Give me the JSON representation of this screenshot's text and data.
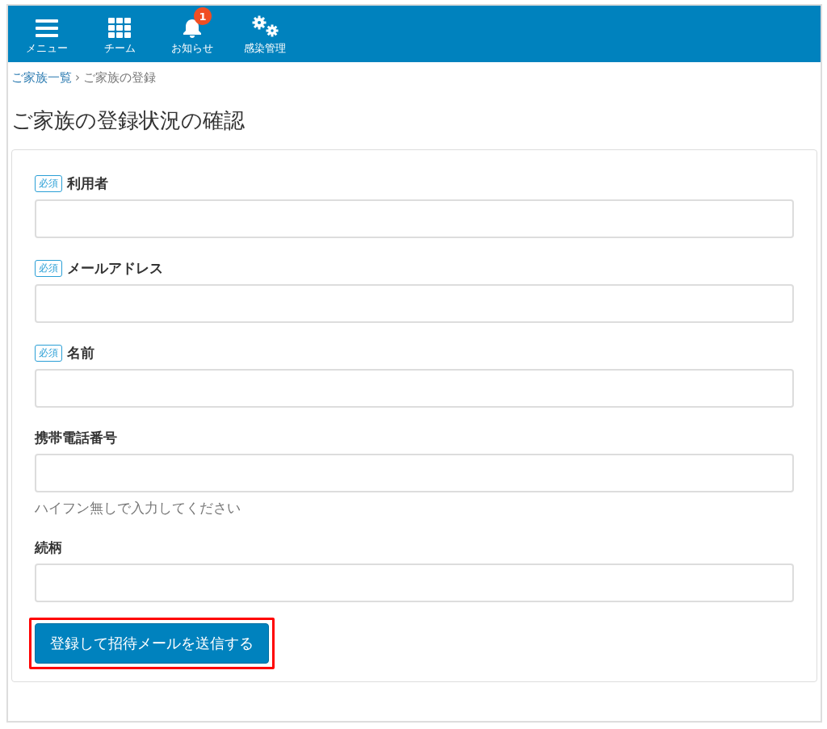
{
  "nav": {
    "items": [
      {
        "label": "メニュー",
        "kind": "menu"
      },
      {
        "label": "チーム",
        "kind": "grid"
      },
      {
        "label": "お知らせ",
        "kind": "bell",
        "badge": "1"
      },
      {
        "label": "感染管理",
        "kind": "gears"
      }
    ]
  },
  "breadcrumb": {
    "link": "ご家族一覧",
    "separator": "›",
    "current": "ご家族の登録"
  },
  "title": "ご家族の登録状況の確認",
  "form": {
    "fields": [
      {
        "label": "利用者",
        "required": true,
        "required_label": "必須"
      },
      {
        "label": "メールアドレス",
        "required": true,
        "required_label": "必須"
      },
      {
        "label": "名前",
        "required": true,
        "required_label": "必須"
      },
      {
        "label": "携帯電話番号",
        "required": false,
        "hint": "ハイフン無しで入力してください"
      },
      {
        "label": "続柄",
        "required": false
      }
    ],
    "submit": {
      "label": "登録して招待メールを送信する",
      "highlighted": true
    }
  }
}
